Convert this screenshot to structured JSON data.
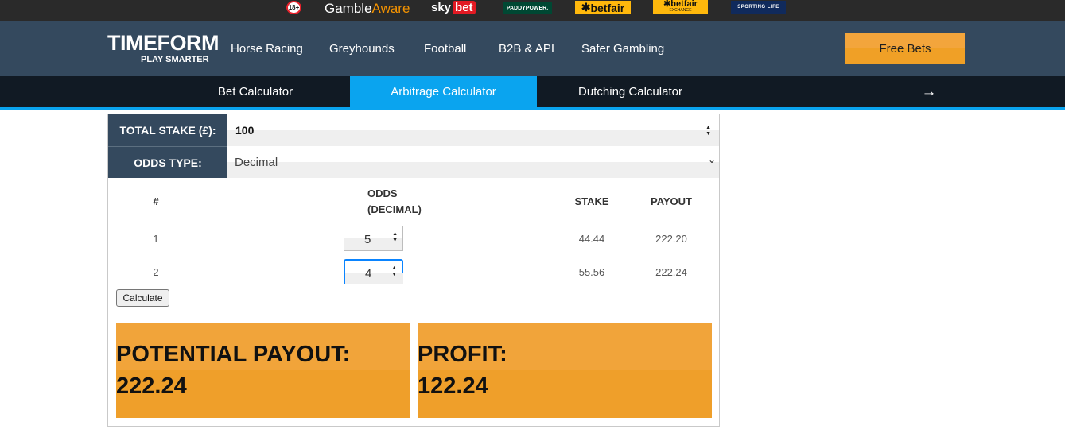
{
  "sponsors": {
    "age_badge": "18+",
    "gamble_aware": {
      "prefix": "Gamble",
      "suffix": "Aware"
    },
    "sky_bet": {
      "sky": "sky",
      "bet": "bet"
    },
    "paddy_power": "PADDYPOWER.",
    "betfair": "betfair",
    "betfair_exchange": {
      "name": "betfair",
      "sub": "EXCHANGE"
    },
    "sporting_life": "SPORTING LIFE"
  },
  "header": {
    "logo_main": "TIMEFORM",
    "logo_sub": "PLAY SMARTER",
    "nav": [
      "Horse Racing",
      "Greyhounds",
      "Football",
      "B2B & API",
      "Safer Gambling"
    ],
    "free_bets": "Free Bets"
  },
  "tabs": {
    "items": [
      "Bet Calculator",
      "Arbitrage Calculator",
      "Dutching Calculator"
    ],
    "active": "Arbitrage Calculator",
    "arrow": "→"
  },
  "calculator": {
    "total_stake_label": "TOTAL STAKE (£):",
    "total_stake_value": "100",
    "odds_type_label": "ODDS TYPE:",
    "odds_type_value": "Decimal",
    "columns": {
      "num": "#",
      "odds": "ODDS",
      "odds_sub": "(DECIMAL)",
      "stake": "STAKE",
      "payout": "PAYOUT"
    },
    "rows": [
      {
        "num": "1",
        "odds": "5",
        "stake": "44.44",
        "payout": "222.20"
      },
      {
        "num": "2",
        "odds": "4",
        "stake": "55.56",
        "payout": "222.24"
      }
    ],
    "calculate_button": "Calculate",
    "potential_payout_label": "POTENTIAL PAYOUT:",
    "potential_payout_value": "222.24",
    "profit_label": "PROFIT:",
    "profit_value": "122.24"
  },
  "colors": {
    "header_bg": "#34495e",
    "tab_active": "#0aa4ef",
    "accent_orange": "#f0a026"
  }
}
